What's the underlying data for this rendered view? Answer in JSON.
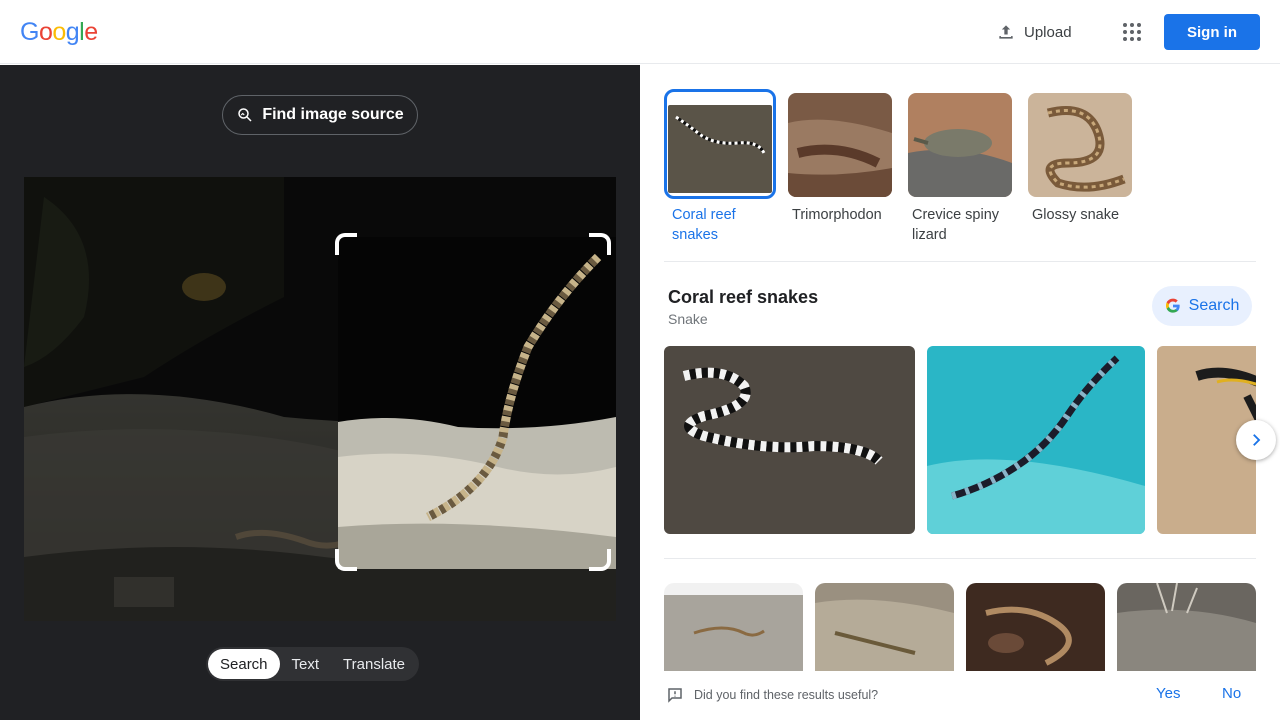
{
  "header": {
    "logo_letters": [
      "G",
      "o",
      "o",
      "g",
      "l",
      "e"
    ],
    "logo_colors": [
      "#4285f4",
      "#ea4335",
      "#fbbc05",
      "#4285f4",
      "#34a853",
      "#ea4335"
    ],
    "upload_label": "Upload",
    "signin_label": "Sign in"
  },
  "left": {
    "find_source_label": "Find image source",
    "tabs": [
      {
        "label": "Search",
        "active": true
      },
      {
        "label": "Text",
        "active": false
      },
      {
        "label": "Translate",
        "active": false
      }
    ]
  },
  "right": {
    "chips": [
      {
        "label": "Coral reef snakes",
        "selected": true
      },
      {
        "label": "Trimorphodon",
        "selected": false
      },
      {
        "label": "Crevice spiny lizard",
        "selected": false
      },
      {
        "label": "Glossy snake",
        "selected": false
      }
    ],
    "entity": {
      "title": "Coral reef snakes",
      "subtitle": "Snake",
      "search_label": "Search"
    },
    "feedback": {
      "question": "Did you find these results useful?",
      "yes": "Yes",
      "no": "No"
    }
  },
  "colors": {
    "accent": "#1a73e8",
    "dark_panel": "#202124"
  }
}
